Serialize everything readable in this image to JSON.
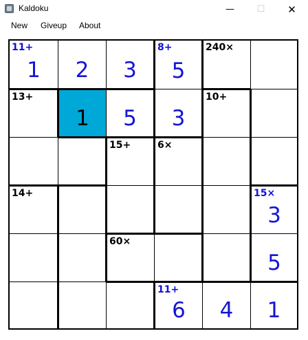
{
  "window": {
    "title": "Kaldoku",
    "app_icon": "calculator-icon",
    "minimize_symbol": "—",
    "maximize_symbol": "☐",
    "close_symbol": "✕"
  },
  "menu": {
    "new": "New",
    "giveup": "Giveup",
    "about": "About"
  },
  "colors": {
    "entered_digit": "#1515d6",
    "solved_clue": "#1010d8",
    "selected_cell": "#00a8d8",
    "grid_line": "#000000"
  },
  "board": {
    "size": 6,
    "selected": [
      1,
      1
    ],
    "clues": [
      {
        "row": 0,
        "col": 0,
        "text": "11+",
        "solved": true
      },
      {
        "row": 0,
        "col": 3,
        "text": "8+",
        "solved": true
      },
      {
        "row": 0,
        "col": 4,
        "text": "240×",
        "solved": false
      },
      {
        "row": 1,
        "col": 0,
        "text": "13+",
        "solved": false
      },
      {
        "row": 1,
        "col": 4,
        "text": "10+",
        "solved": false
      },
      {
        "row": 2,
        "col": 2,
        "text": "15+",
        "solved": false
      },
      {
        "row": 2,
        "col": 3,
        "text": "6×",
        "solved": false
      },
      {
        "row": 3,
        "col": 0,
        "text": "14+",
        "solved": false
      },
      {
        "row": 3,
        "col": 5,
        "text": "15×",
        "solved": true
      },
      {
        "row": 4,
        "col": 2,
        "text": "60×",
        "solved": false
      },
      {
        "row": 5,
        "col": 3,
        "text": "11+",
        "solved": true
      }
    ],
    "values": [
      [
        "1",
        "2",
        "3",
        "5",
        "",
        ""
      ],
      [
        "",
        "1",
        "5",
        "3",
        "",
        ""
      ],
      [
        "",
        "",
        "",
        "",
        "",
        ""
      ],
      [
        "",
        "",
        "",
        "",
        "",
        "3"
      ],
      [
        "",
        "",
        "",
        "",
        "",
        "5"
      ],
      [
        "",
        "",
        "",
        "6",
        "4",
        "1"
      ]
    ]
  }
}
